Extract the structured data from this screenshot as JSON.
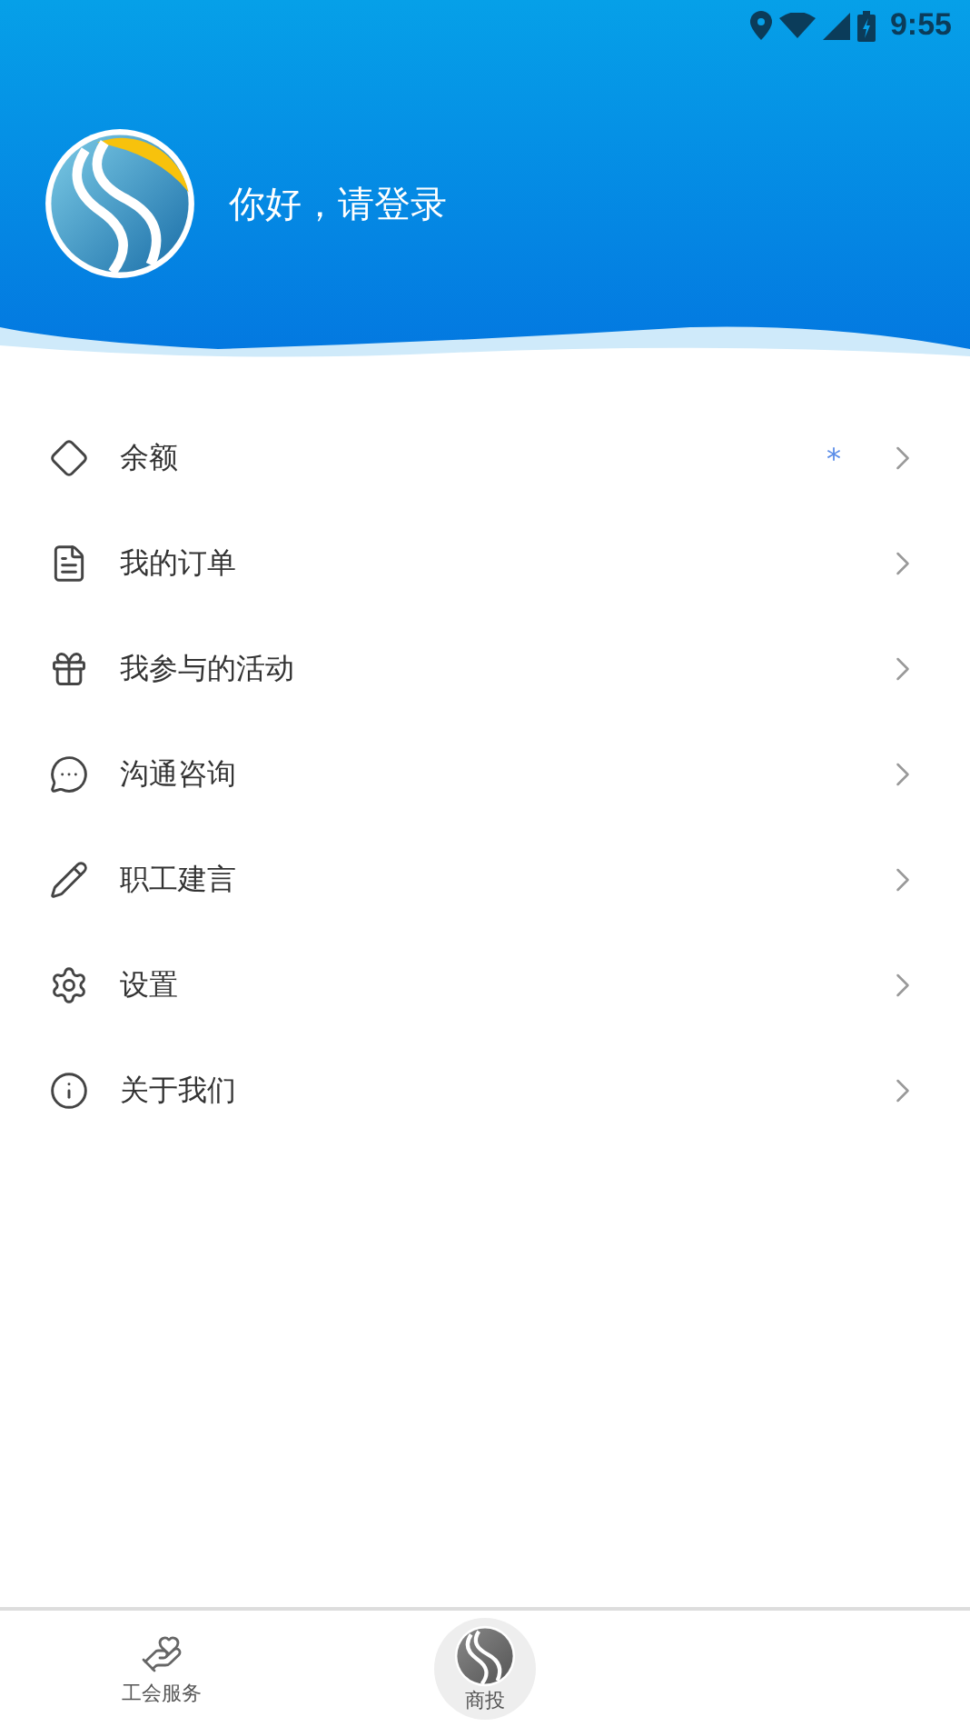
{
  "status_bar": {
    "time": "9:55"
  },
  "profile": {
    "greeting": "你好，请登录"
  },
  "menu": [
    {
      "label": "余额",
      "badge": "*"
    },
    {
      "label": "我的订单"
    },
    {
      "label": "我参与的活动"
    },
    {
      "label": "沟通咨询"
    },
    {
      "label": "职工建言"
    },
    {
      "label": "设置"
    },
    {
      "label": "关于我们"
    }
  ],
  "bottom_nav": [
    {
      "kind": "normal",
      "label": "工会服务"
    },
    {
      "kind": "center",
      "label": "商投"
    }
  ]
}
